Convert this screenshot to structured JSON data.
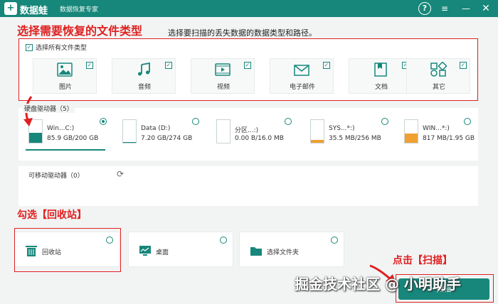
{
  "window": {
    "logo_text": "+",
    "app_name": "数据蛙",
    "app_subtitle": "数据恢复专家",
    "help_label": "?",
    "menu_label": "≡",
    "minimize_label": "—",
    "close_label": "✕"
  },
  "annotations": {
    "select_types": "选择需要恢复的文件类型",
    "check_recycle": "勾选【回收站】",
    "click_scan": "点击【扫描】",
    "watermark": "掘金技术社区 @ 小明助手"
  },
  "instruction": "选择要扫描的丢失数据的数据类型和路径。",
  "file_types": {
    "select_all_label": "选择所有文件类型",
    "select_all_checked": true,
    "items": [
      {
        "label": "图片",
        "icon": "image-icon",
        "checked": true
      },
      {
        "label": "音频",
        "icon": "music-icon",
        "checked": true
      },
      {
        "label": "视频",
        "icon": "video-icon",
        "checked": true
      },
      {
        "label": "电子邮件",
        "icon": "email-icon",
        "checked": true
      },
      {
        "label": "文档",
        "icon": "document-icon",
        "checked": true
      },
      {
        "label": "其它",
        "icon": "other-icon",
        "checked": true
      }
    ]
  },
  "hard_drives": {
    "label": "硬盘驱动器（5）",
    "items": [
      {
        "name": "Win...C:)",
        "size": "85.9 GB/200 GB",
        "used_fraction": 0.43,
        "fill_color": "#16877a",
        "selected": true
      },
      {
        "name": "Data (D:)",
        "size": "7.20 GB/274 GB",
        "used_fraction": 0.03,
        "fill_color": "#16877a",
        "selected": false
      },
      {
        "name": "分区...:)",
        "size": "0.00 B/16.0 MB",
        "used_fraction": 0.0,
        "fill_color": "#f0a030",
        "selected": false
      },
      {
        "name": "SYS...*:)",
        "size": "35.5 MB/256 MB",
        "used_fraction": 0.14,
        "fill_color": "#f0a030",
        "selected": false
      },
      {
        "name": "WIN...*:)",
        "size": "817 MB/1.95 GB",
        "used_fraction": 0.42,
        "fill_color": "#f0a030",
        "selected": false
      }
    ]
  },
  "removable_drives": {
    "label": "可移动驱动器（0）",
    "refresh_icon": "refresh-icon"
  },
  "locations": [
    {
      "label": "回收站",
      "icon": "trash-icon"
    },
    {
      "label": "桌面",
      "icon": "desktop-icon"
    },
    {
      "label": "选择文件夹",
      "icon": "folder-icon"
    }
  ],
  "scan_button": "扫描",
  "colors": {
    "accent": "#16877a",
    "annotation": "#e02020",
    "warn": "#f0a030"
  }
}
